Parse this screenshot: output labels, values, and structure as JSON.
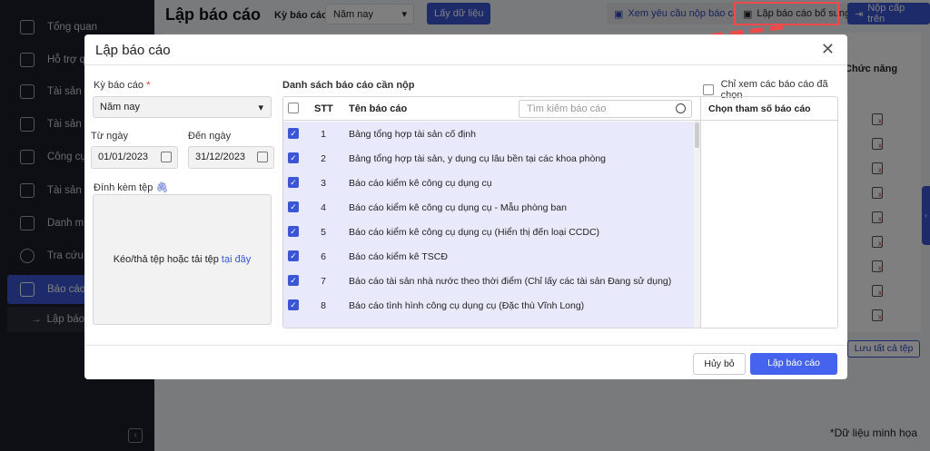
{
  "sidebar": {
    "items": [
      {
        "label": "Tổng quan",
        "icon": "chart-monitor-icon"
      },
      {
        "label": "Hỗ trợ quy",
        "icon": "clipboard-icon"
      },
      {
        "label": "Tài sản",
        "icon": "car-home-icon"
      },
      {
        "label": "Tài sản HT",
        "icon": "road-icon"
      },
      {
        "label": "Công cụ d",
        "icon": "paint-roller-icon"
      },
      {
        "label": "Tài sản xã",
        "icon": "car-home-icon"
      },
      {
        "label": "Danh mục",
        "icon": "list-icon"
      },
      {
        "label": "Tra cứu",
        "icon": "search-icon"
      },
      {
        "label": "Báo cáo",
        "icon": "bar-chart-icon",
        "active": true
      }
    ],
    "sub_item": "Lập báo c"
  },
  "page": {
    "title": "Lập báo cáo",
    "period_label": "Kỳ báo cáo",
    "period_value": "Năm nay",
    "fetch_button": "Lấy dữ liệu",
    "view_requests_button": "Xem yêu cầu nộp báo cáo",
    "supplement_button": "Lập báo cáo bổ sung",
    "submit_button": "Nộp cấp trên",
    "column_function": "Chức năng",
    "save_all_button": "Lưu tất cả tệp",
    "note": "*Dữ liệu minh họa"
  },
  "modal": {
    "title": "Lập báo cáo",
    "period_label": "Kỳ báo cáo",
    "period_required": "*",
    "period_value": "Năm nay",
    "from_label": "Từ ngày",
    "from_value": "01/01/2023",
    "to_label": "Đến ngày",
    "to_value": "31/12/2023",
    "attach_label": "Đính kèm tệp",
    "drop_text": "Kéo/thả tệp hoặc tải tệp",
    "drop_link": "tại đây",
    "list_title": "Danh sách báo cáo cần nộp",
    "only_selected_label": "Chỉ xem các báo cáo đã chọn",
    "col_stt": "STT",
    "col_name": "Tên báo cáo",
    "search_placeholder": "Tìm kiếm báo cáo",
    "param_header": "Chọn tham số báo cáo",
    "rows": [
      {
        "stt": "1",
        "name": "Bảng tổng hợp tài sản cố định",
        "checked": true
      },
      {
        "stt": "2",
        "name": "Bảng tổng hợp tài sản, y dụng cụ lâu bền tại các khoa phòng",
        "checked": true
      },
      {
        "stt": "3",
        "name": "Báo cáo kiểm kê công cụ dụng cụ",
        "checked": true
      },
      {
        "stt": "4",
        "name": "Báo cáo kiểm kê công cụ dụng cụ - Mẫu phòng ban",
        "checked": true
      },
      {
        "stt": "5",
        "name": "Báo cáo kiểm kê công cụ dụng cụ (Hiển thị đến loại CCDC)",
        "checked": true
      },
      {
        "stt": "6",
        "name": "Báo cáo kiểm kê TSCĐ",
        "checked": true
      },
      {
        "stt": "7",
        "name": "Báo cáo tài sản nhà nước theo thời điểm (Chỉ lấy các tài sản Đang sử dụng)",
        "checked": true
      },
      {
        "stt": "8",
        "name": "Báo cáo tình hình công cụ dụng cụ (Đặc thù Vĩnh Long)",
        "checked": true
      }
    ],
    "cancel_button": "Hủy bỏ",
    "create_button": "Lập báo cáo"
  },
  "colors": {
    "accent": "#3a56d4",
    "highlight": "#f04a4a",
    "row_bg": "#e8eafc"
  }
}
